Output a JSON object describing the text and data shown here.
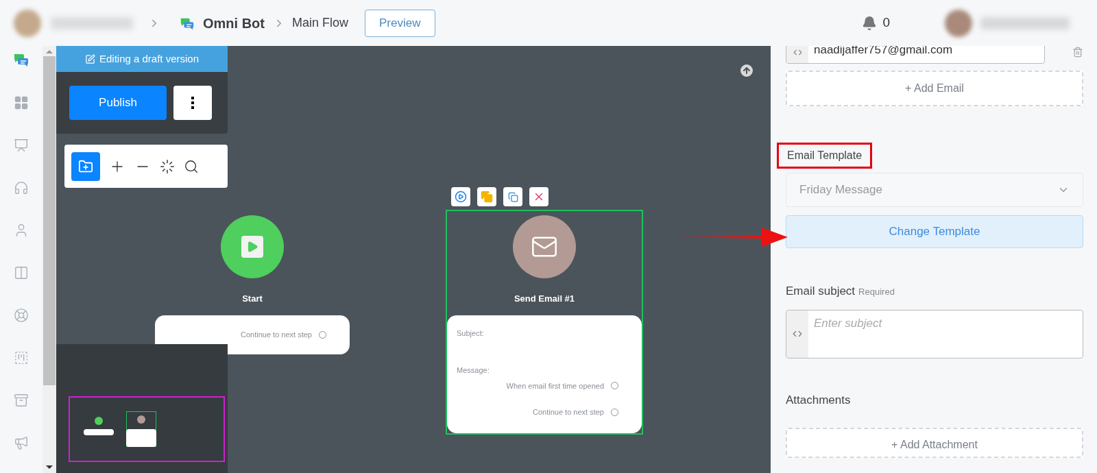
{
  "breadcrumb": {
    "bot": "Omni Bot",
    "flow": "Main Flow"
  },
  "header": {
    "preview_button": "Preview",
    "notification_count": "0"
  },
  "editor": {
    "banner": "Editing a draft version",
    "publish_button": "Publish"
  },
  "canvas": {
    "nodes": [
      {
        "kind": "start",
        "title": "Start",
        "selected": false,
        "outputs": [
          "Continue to next step"
        ]
      },
      {
        "kind": "email",
        "title": "Send Email #1",
        "selected": true,
        "fields": [
          "Subject:",
          "Message:"
        ],
        "outputs": [
          "When email first time opened",
          "Continue to next step"
        ]
      }
    ]
  },
  "panel": {
    "email_recipient": "naadijaffer757@gmail.com",
    "add_email": "+ Add Email",
    "template_label": "Email Template",
    "template_value": "Friday Message",
    "change_template": "Change Template",
    "subject_label": "Email subject",
    "subject_required": "Required",
    "subject_placeholder": "Enter subject",
    "attachments_label": "Attachments",
    "add_attachment": "+ Add Attachment"
  }
}
